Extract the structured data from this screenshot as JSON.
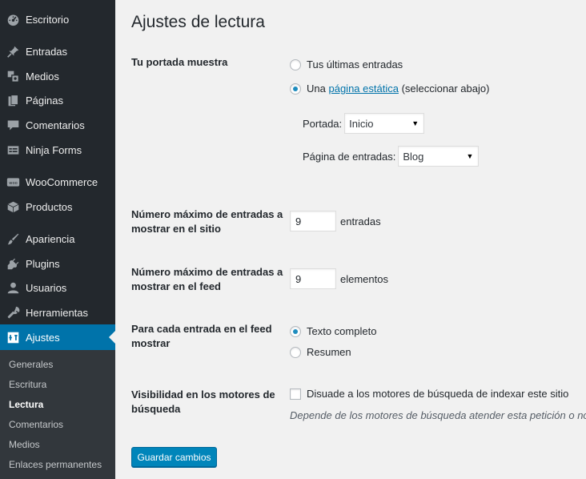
{
  "sidebar": {
    "items": [
      {
        "label": "Escritorio",
        "icon": "dashboard-icon"
      },
      {
        "label": "Entradas",
        "icon": "pin-icon"
      },
      {
        "label": "Medios",
        "icon": "media-icon"
      },
      {
        "label": "Páginas",
        "icon": "pages-icon"
      },
      {
        "label": "Comentarios",
        "icon": "comment-icon"
      },
      {
        "label": "Ninja Forms",
        "icon": "forms-icon"
      },
      {
        "label": "WooCommerce",
        "icon": "woo-icon"
      },
      {
        "label": "Productos",
        "icon": "box-icon"
      },
      {
        "label": "Apariencia",
        "icon": "brush-icon"
      },
      {
        "label": "Plugins",
        "icon": "plugin-icon"
      },
      {
        "label": "Usuarios",
        "icon": "user-icon"
      },
      {
        "label": "Herramientas",
        "icon": "wrench-icon"
      },
      {
        "label": "Ajustes",
        "icon": "settings-icon"
      }
    ],
    "submenu": [
      "Generales",
      "Escritura",
      "Lectura",
      "Comentarios",
      "Medios",
      "Enlaces permanentes"
    ],
    "current_item": "Ajustes",
    "current_sub": "Lectura",
    "colors": {
      "bg": "#23282d",
      "current": "#0073aa",
      "submenu_bg": "#32373c"
    }
  },
  "page": {
    "title": "Ajustes de lectura",
    "front_page": {
      "label": "Tu portada muestra",
      "option_latest": "Tus últimas entradas",
      "option_static_prefix": "Una",
      "option_static_link": "página estática",
      "option_static_suffix": "(seleccionar abajo)",
      "selected": "static",
      "portada_label": "Portada:",
      "portada_value": "Inicio",
      "entries_page_label": "Página de entradas:",
      "entries_page_value": "Blog"
    },
    "posts_per_page": {
      "label": "Número máximo de entradas a mostrar en el sitio",
      "value": "9",
      "unit": "entradas"
    },
    "posts_per_feed": {
      "label": "Número máximo de entradas a mostrar en el feed",
      "value": "9",
      "unit": "elementos"
    },
    "feed_content": {
      "label": "Para cada entrada en el feed mostrar",
      "option_full": "Texto completo",
      "option_summary": "Resumen",
      "selected": "full"
    },
    "search_visibility": {
      "label": "Visibilidad en los motores de búsqueda",
      "checkbox_label": "Disuade a los motores de búsqueda de indexar este sitio",
      "checked": false,
      "hint": "Depende de los motores de búsqueda atender esta petición o no."
    },
    "save_button": "Guardar cambios"
  }
}
